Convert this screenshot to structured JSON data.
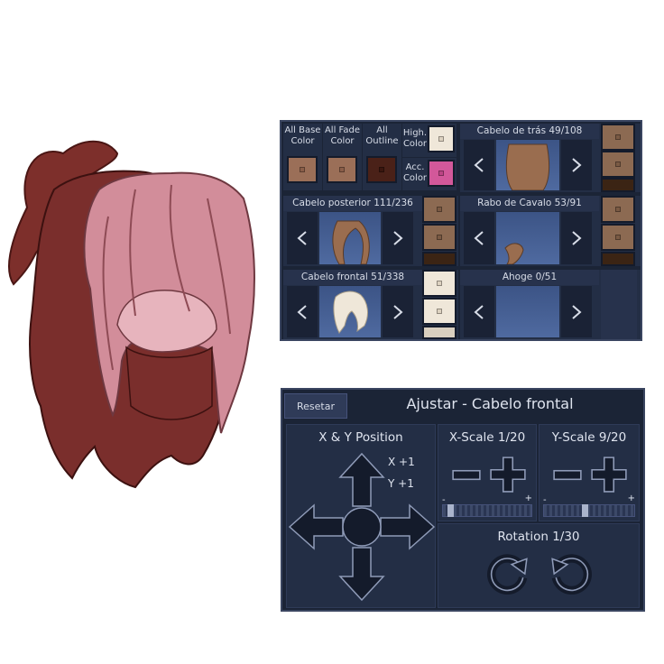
{
  "panel": {
    "all_base_label": "All Base\nColor",
    "all_fade_label": "All Fade\nColor",
    "all_outline_label": "All\nOutline",
    "high_color_label": "High.\nColor",
    "acc_color_label": "Acc.\nColor",
    "colors": {
      "all_base": "#9b6f58",
      "all_fade": "#9b6f58",
      "all_outline": "#4a2118",
      "high": "#efe7d9",
      "acc": "#d2589a"
    },
    "back_hair": {
      "title": "Cabelo de trás 49/108",
      "swatches": [
        "#8c6a52",
        "#8c6a52",
        "#3b2414"
      ]
    },
    "posterior_hair": {
      "title": "Cabelo posterior 111/236",
      "swatches": [
        "#8c6a52",
        "#8c6a52",
        "#3b2414"
      ]
    },
    "ponytail": {
      "title": "Rabo de Cavalo 53/91",
      "swatches": [
        "#8c6a52",
        "#8c6a52",
        "#3b2414"
      ]
    },
    "front_hair": {
      "title": "Cabelo frontal 51/338",
      "swatches": [
        "#efe7d9",
        "#efe7d9",
        "#d9cfbf"
      ]
    },
    "ahoge": {
      "title": "Ahoge 0/51"
    }
  },
  "adjust": {
    "reset_label": "Resetar",
    "title": "Ajustar - Cabelo frontal",
    "position_title": "X & Y Position",
    "x_value": "X +1",
    "y_value": "Y +1",
    "xscale_title": "X-Scale 1/20",
    "yscale_title": "Y-Scale 9/20",
    "xscale_fraction": 0.05,
    "yscale_fraction": 0.45,
    "minus_sign": "-",
    "plus_sign": "+",
    "rotation_title": "Rotation 1/30"
  }
}
